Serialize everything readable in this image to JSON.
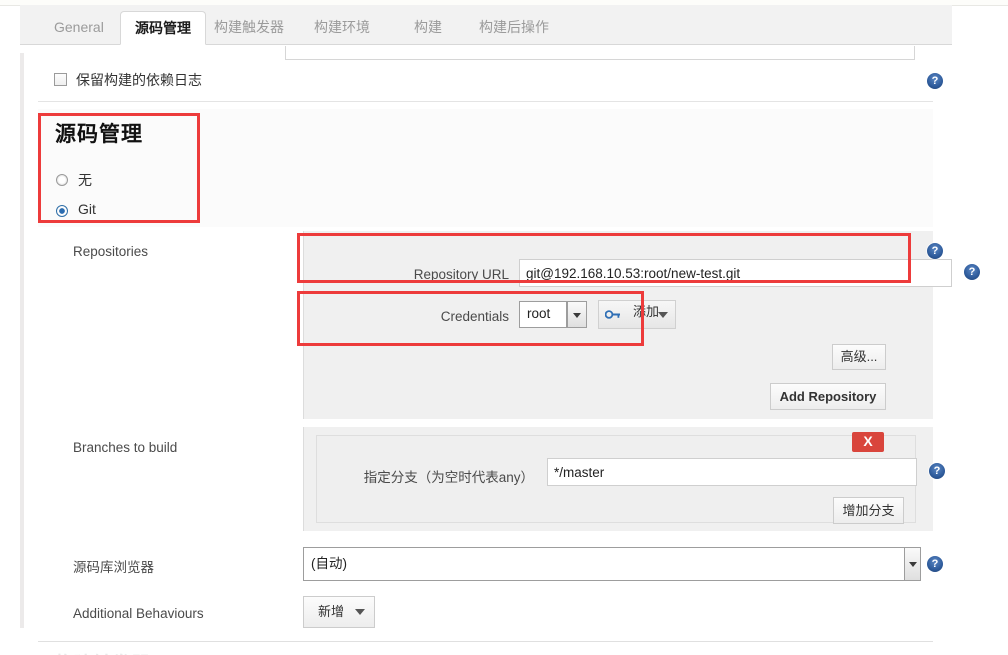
{
  "tabs": [
    {
      "label": "General",
      "active": false
    },
    {
      "label": "源码管理",
      "active": true
    },
    {
      "label": "构建触发器",
      "active": false
    },
    {
      "label": "构建环境",
      "active": false
    },
    {
      "label": "构建",
      "active": false
    },
    {
      "label": "构建后操作",
      "active": false
    }
  ],
  "keep_dependencies": {
    "label": "保留构建的依赖日志",
    "checked": false
  },
  "scm": {
    "heading": "源码管理",
    "options": [
      {
        "label": "无",
        "selected": false
      },
      {
        "label": "Git",
        "selected": true
      }
    ]
  },
  "repositories": {
    "label": "Repositories",
    "repository_url": {
      "label": "Repository URL",
      "value": "git@192.168.10.53:root/new-test.git"
    },
    "credentials": {
      "label": "Credentials",
      "value": "root",
      "add_button": "添加"
    },
    "advanced_button": "高级...",
    "add_repository_button": "Add Repository"
  },
  "branches": {
    "label": "Branches to build",
    "branch_spec": {
      "label": "指定分支（为空时代表any）",
      "value": "*/master"
    },
    "delete_button": "X",
    "add_branch_button": "增加分支"
  },
  "repo_browser": {
    "label": "源码库浏览器",
    "value": "(自动)"
  },
  "additional_behaviours": {
    "label": "Additional Behaviours",
    "add_button": "新增"
  },
  "help_icon_glyph": "?",
  "colors": {
    "annotation": "#ed3b3b",
    "delete": "#d9453c",
    "help": "#2e5b9b"
  }
}
